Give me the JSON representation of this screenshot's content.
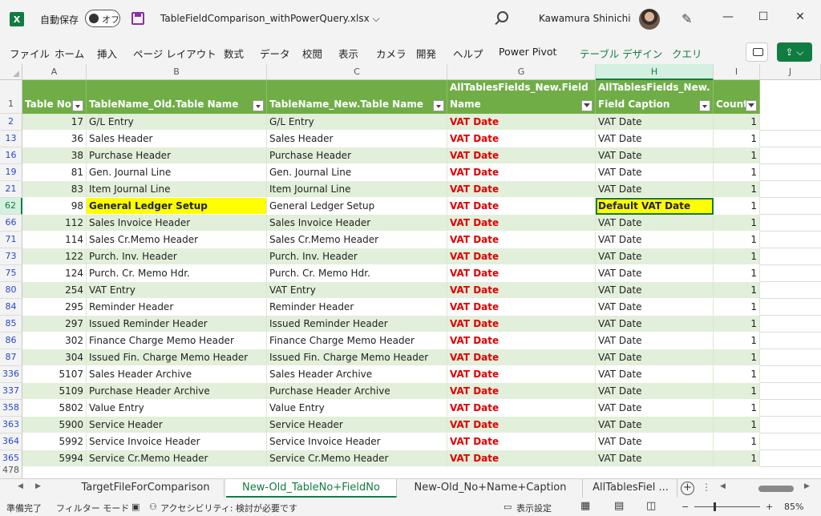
{
  "titlebar": {
    "autosave_label": "自動保存",
    "autosave_state": "オフ",
    "filename": "TableFieldComparison_withPowerQuery.xlsx ⌵",
    "user": "Kawamura Shinichi",
    "minimize": "—",
    "maximize": "☐",
    "close": "✕"
  },
  "ribbon": {
    "tabs": [
      "ファイル",
      "ホーム",
      "挿入",
      "ページ レイアウト",
      "数式",
      "データ",
      "校閲",
      "表示",
      "カメラ",
      "開発",
      "ヘルプ",
      "Power Pivot",
      "テーブル デザイン",
      "クエリ"
    ],
    "share_label": "⇪ ⌵"
  },
  "columns": [
    "A",
    "B",
    "C",
    "G",
    "H",
    "I",
    "J"
  ],
  "header_row": {
    "row_number": "1",
    "a": "Table No.",
    "b": "TableName_Old.Table Name",
    "c": "TableName_New.Table Name",
    "g_line1": "AllTablesFields_New.Field",
    "g_line2": "Name",
    "h_line1": "AllTablesFields_New.",
    "h_line2": "Field Caption",
    "i": "Count"
  },
  "rows": [
    {
      "rn": "2",
      "no": "17",
      "old": "G/L Entry",
      "new": "G/L Entry",
      "field": "VAT Date",
      "caption": "VAT Date",
      "count": "1"
    },
    {
      "rn": "13",
      "no": "36",
      "old": "Sales Header",
      "new": "Sales Header",
      "field": "VAT Date",
      "caption": "VAT Date",
      "count": "1"
    },
    {
      "rn": "16",
      "no": "38",
      "old": "Purchase Header",
      "new": "Purchase Header",
      "field": "VAT Date",
      "caption": "VAT Date",
      "count": "1"
    },
    {
      "rn": "19",
      "no": "81",
      "old": "Gen. Journal Line",
      "new": "Gen. Journal Line",
      "field": "VAT Date",
      "caption": "VAT Date",
      "count": "1"
    },
    {
      "rn": "21",
      "no": "83",
      "old": "Item Journal Line",
      "new": "Item Journal Line",
      "field": "VAT Date",
      "caption": "VAT Date",
      "count": "1"
    },
    {
      "rn": "62",
      "no": "98",
      "old": "General Ledger Setup",
      "new": "General Ledger Setup",
      "field": "VAT Date",
      "caption": "Default VAT Date",
      "count": "1"
    },
    {
      "rn": "66",
      "no": "112",
      "old": "Sales Invoice Header",
      "new": "Sales Invoice Header",
      "field": "VAT Date",
      "caption": "VAT Date",
      "count": "1"
    },
    {
      "rn": "71",
      "no": "114",
      "old": "Sales Cr.Memo Header",
      "new": "Sales Cr.Memo Header",
      "field": "VAT Date",
      "caption": "VAT Date",
      "count": "1"
    },
    {
      "rn": "73",
      "no": "122",
      "old": "Purch. Inv. Header",
      "new": "Purch. Inv. Header",
      "field": "VAT Date",
      "caption": "VAT Date",
      "count": "1"
    },
    {
      "rn": "75",
      "no": "124",
      "old": "Purch. Cr. Memo Hdr.",
      "new": "Purch. Cr. Memo Hdr.",
      "field": "VAT Date",
      "caption": "VAT Date",
      "count": "1"
    },
    {
      "rn": "80",
      "no": "254",
      "old": "VAT Entry",
      "new": "VAT Entry",
      "field": "VAT Date",
      "caption": "VAT Date",
      "count": "1"
    },
    {
      "rn": "84",
      "no": "295",
      "old": "Reminder Header",
      "new": "Reminder Header",
      "field": "VAT Date",
      "caption": "VAT Date",
      "count": "1"
    },
    {
      "rn": "85",
      "no": "297",
      "old": "Issued Reminder Header",
      "new": "Issued Reminder Header",
      "field": "VAT Date",
      "caption": "VAT Date",
      "count": "1"
    },
    {
      "rn": "86",
      "no": "302",
      "old": "Finance Charge Memo Header",
      "new": "Finance Charge Memo Header",
      "field": "VAT Date",
      "caption": "VAT Date",
      "count": "1"
    },
    {
      "rn": "87",
      "no": "304",
      "old": "Issued Fin. Charge Memo Header",
      "new": "Issued Fin. Charge Memo Header",
      "field": "VAT Date",
      "caption": "VAT Date",
      "count": "1"
    },
    {
      "rn": "336",
      "no": "5107",
      "old": "Sales Header Archive",
      "new": "Sales Header Archive",
      "field": "VAT Date",
      "caption": "VAT Date",
      "count": "1"
    },
    {
      "rn": "337",
      "no": "5109",
      "old": "Purchase Header Archive",
      "new": "Purchase Header Archive",
      "field": "VAT Date",
      "caption": "VAT Date",
      "count": "1"
    },
    {
      "rn": "358",
      "no": "5802",
      "old": "Value Entry",
      "new": "Value Entry",
      "field": "VAT Date",
      "caption": "VAT Date",
      "count": "1"
    },
    {
      "rn": "363",
      "no": "5900",
      "old": "Service Header",
      "new": "Service Header",
      "field": "VAT Date",
      "caption": "VAT Date",
      "count": "1"
    },
    {
      "rn": "364",
      "no": "5992",
      "old": "Service Invoice Header",
      "new": "Service Invoice Header",
      "field": "VAT Date",
      "caption": "VAT Date",
      "count": "1"
    },
    {
      "rn": "365",
      "no": "5994",
      "old": "Service Cr.Memo Header",
      "new": "Service Cr.Memo Header",
      "field": "VAT Date",
      "caption": "VAT Date",
      "count": "1"
    }
  ],
  "empty_row_number": "478",
  "highlight_row": "62",
  "sheets": [
    "TargetFileForComparison",
    "New-Old_TableNo+FieldNo",
    "New-Old_No+Name+Caption",
    "AllTablesFiel ..."
  ],
  "active_sheet": "New-Old_TableNo+FieldNo",
  "statusbar": {
    "ready": "準備完了",
    "filter_mode": "フィルター モード",
    "accessibility": "アクセシビリティ: 検討が必要です",
    "display_settings": "表示設定",
    "zoom": "85%"
  },
  "colors": {
    "header_green": "#70ad47",
    "band_green": "#e2efda",
    "red_text": "#e00000",
    "highlight_yellow": "#ffff00",
    "excel_green": "#107c41"
  }
}
